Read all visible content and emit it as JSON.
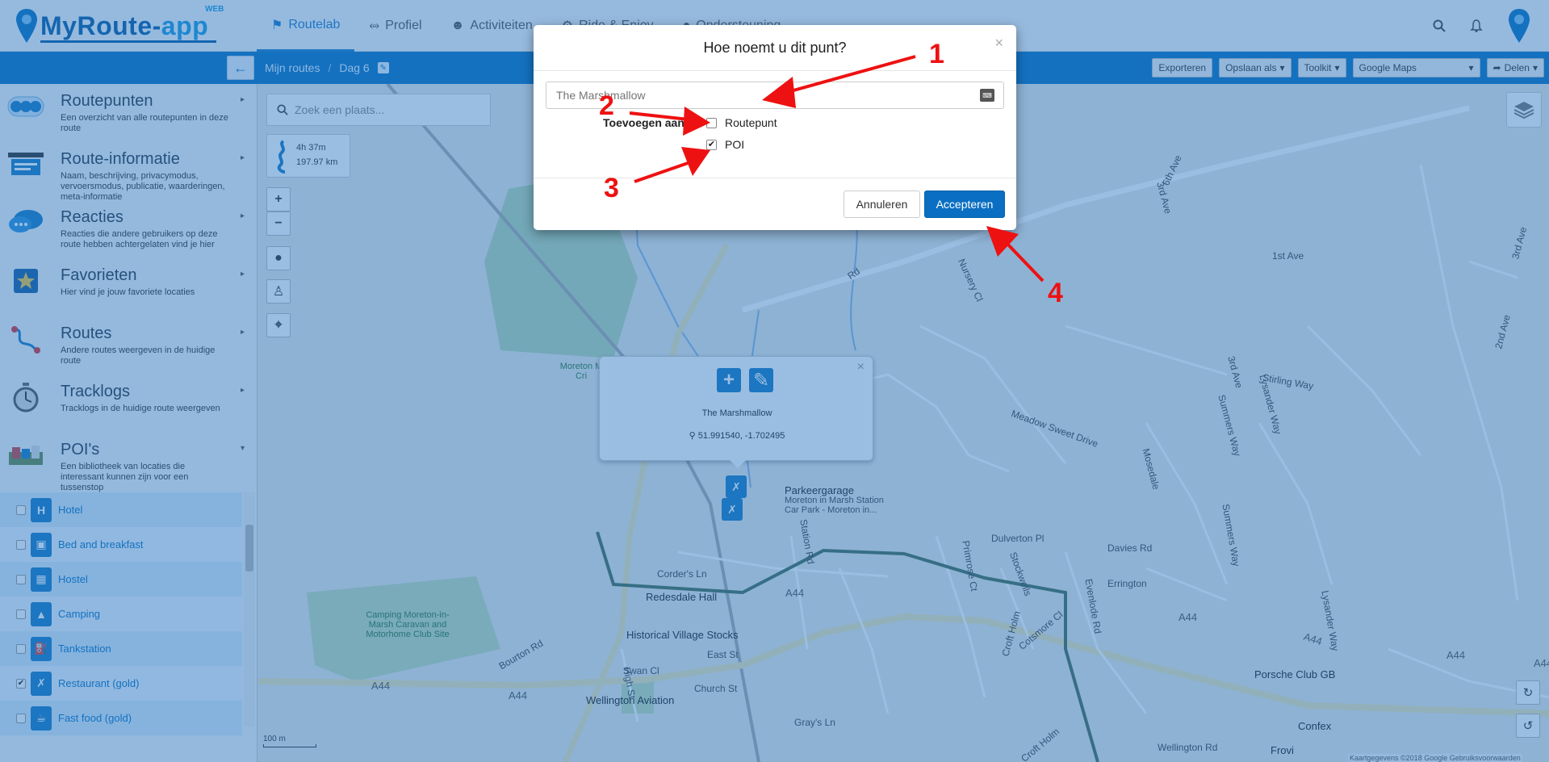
{
  "app": {
    "logo_text_main": "MyRoute-",
    "logo_text_app": "app",
    "logo_badge": "WEB"
  },
  "nav": {
    "items": [
      {
        "label": "Routelab",
        "icon": "map-marker-icon",
        "active": true
      },
      {
        "label": "Profiel",
        "icon": "share-icon"
      },
      {
        "label": "Activiteiten",
        "icon": "users-icon"
      },
      {
        "label": "Ride & Enjoy",
        "icon": "motorbike-icon"
      },
      {
        "label": "Ondersteuning",
        "icon": "globe-icon"
      }
    ]
  },
  "breadcrumb": {
    "root": "Mijn routes",
    "separator": "/",
    "current": "Dag 6"
  },
  "toolbar": {
    "export": "Exporteren",
    "save_as": "Opslaan als",
    "toolkit": "Toolkit",
    "map_provider": "Google Maps",
    "share": "Delen"
  },
  "sidebar": {
    "sections": [
      {
        "title": "Routepunten",
        "desc": "Een overzicht van alle routepunten in deze route"
      },
      {
        "title": "Route-informatie",
        "desc": "Naam, beschrijving, privacymodus, vervoersmodus, publicatie, waarderingen, meta-informatie"
      },
      {
        "title": "Reacties",
        "desc": "Reacties die andere gebruikers op deze route hebben achtergelaten vind je hier"
      },
      {
        "title": "Favorieten",
        "desc": "Hier vind je jouw favoriete locaties"
      },
      {
        "title": "Routes",
        "desc": "Andere routes weergeven in de huidige route"
      },
      {
        "title": "Tracklogs",
        "desc": "Tracklogs in de huidige route weergeven"
      },
      {
        "title": "POI's",
        "desc": "Een bibliotheek van locaties die interessant kunnen zijn voor een tussenstop"
      }
    ],
    "poi_categories": [
      {
        "label": "Hotel",
        "checked": false,
        "icon": "H"
      },
      {
        "label": "Bed and breakfast",
        "checked": false,
        "icon": "bed-icon"
      },
      {
        "label": "Hostel",
        "checked": false,
        "icon": "hostel-icon"
      },
      {
        "label": "Camping",
        "checked": false,
        "icon": "camping-icon"
      },
      {
        "label": "Tankstation",
        "checked": false,
        "icon": "fuel-icon"
      },
      {
        "label": "Restaurant (gold)",
        "checked": true,
        "icon": "restaurant-icon"
      },
      {
        "label": "Fast food (gold)",
        "checked": false,
        "icon": "fastfood-icon"
      }
    ]
  },
  "map": {
    "search_placeholder": "Zoek een plaats...",
    "route_time": "4h 37m",
    "route_distance": "197.97 km",
    "scale": "100 m",
    "attribution": "Kaartgegevens ©2018 Google   Gebruiksvoorwaarden",
    "labels": {
      "parking_title": "Parkeergarage",
      "parking_sub": "Moreton in Marsh Station Car Park - Moreton in...",
      "redesdale": "Redesdale Hall",
      "historical": "Historical Village Stocks",
      "wellington": "Wellington Aviation",
      "porsche": "Porsche Club GB",
      "confex": "Confex",
      "frovi": "Frovi",
      "camping": "Camping Moreton-in-Marsh Caravan and Motorhome Club Site",
      "moreton": "Moreton M Cri",
      "a44": "A44",
      "bourton": "Bourton Rd",
      "high_st": "High St",
      "swan": "Swan Cl",
      "east_st": "East St",
      "church": "Church St",
      "grays": "Gray's Ln",
      "corders": "Corder's Ln",
      "station": "Station Rd",
      "dulverton": "Dulverton Pl",
      "davies": "Davies Rd",
      "errington": "Errington",
      "primrose": "Primrose Ct",
      "stockwells": "Stockwells",
      "cotsmore": "Cotsmore Cl",
      "croft_holm": "Croft Holm",
      "croft_holm2": "Croft Holm",
      "evenlode": "Evenlode Rd",
      "wellington_rd": "Wellington Rd",
      "nursery": "Nursery Cl",
      "meadow": "Meadow Sweet Drive",
      "stirling": "Stirling Way",
      "summers": "Summers Way",
      "lysander": "Lysander Way",
      "lysander2": "Lysander Way",
      "mosedale": "Mosedale",
      "summers2": "Summers Way",
      "first_ave": "1st Ave",
      "third_ave": "3rd Ave",
      "third_ave2": "3rd Ave",
      "second_ave": "2nd Ave",
      "sixth_ave": "6th Ave",
      "third_ave3": "3rd Ave",
      "road_rd": "Rd"
    }
  },
  "popup": {
    "name": "The Marshmallow",
    "coords": "51.991540, -1.702495"
  },
  "modal": {
    "title": "Hoe noemt u dit punt?",
    "input_placeholder": "The Marshmallow",
    "add_to_label": "Toevoegen aan",
    "option_routepunt": "Routepunt",
    "option_poi": "POI",
    "routepunt_checked": false,
    "poi_checked": true,
    "cancel": "Annuleren",
    "accept": "Accepteren"
  },
  "annotations": [
    "1",
    "2",
    "3",
    "4"
  ],
  "colors": {
    "brand_blue": "#0b73c2",
    "accent_red": "#ee1111",
    "overlay": "#1e6ebe"
  }
}
